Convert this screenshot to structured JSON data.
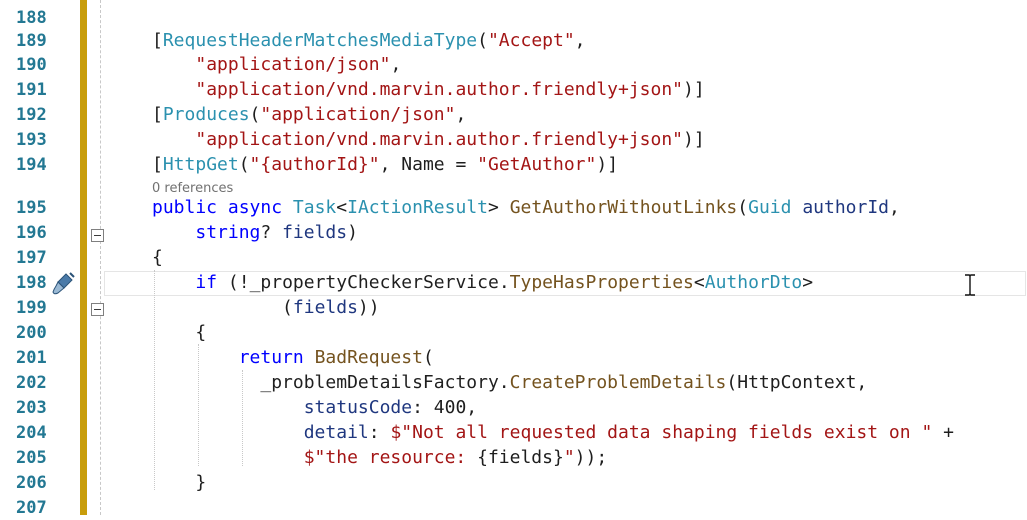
{
  "editor": {
    "codelens": "0 references",
    "lines": [
      {
        "n": "188",
        "tokens": []
      },
      {
        "n": "189",
        "tokens": [
          {
            "t": "[",
            "c": "p"
          },
          {
            "t": "RequestHeaderMatchesMediaType",
            "c": "ty"
          },
          {
            "t": "(",
            "c": "p"
          },
          {
            "t": "\"Accept\"",
            "c": "st"
          },
          {
            "t": ",",
            "c": "p"
          }
        ]
      },
      {
        "n": "190",
        "tokens": [
          {
            "t": "    ",
            "c": "p"
          },
          {
            "t": "\"application/json\"",
            "c": "st"
          },
          {
            "t": ",",
            "c": "p"
          }
        ]
      },
      {
        "n": "191",
        "tokens": [
          {
            "t": "    ",
            "c": "p"
          },
          {
            "t": "\"application/vnd.marvin.author.friendly+json\"",
            "c": "st"
          },
          {
            "t": ")]",
            "c": "p"
          }
        ]
      },
      {
        "n": "192",
        "tokens": [
          {
            "t": "[",
            "c": "p"
          },
          {
            "t": "Produces",
            "c": "ty"
          },
          {
            "t": "(",
            "c": "p"
          },
          {
            "t": "\"application/json\"",
            "c": "st"
          },
          {
            "t": ",",
            "c": "p"
          }
        ]
      },
      {
        "n": "193",
        "tokens": [
          {
            "t": "    ",
            "c": "p"
          },
          {
            "t": "\"application/vnd.marvin.author.friendly+json\"",
            "c": "st"
          },
          {
            "t": ")]",
            "c": "p"
          }
        ]
      },
      {
        "n": "194",
        "tokens": [
          {
            "t": "[",
            "c": "p"
          },
          {
            "t": "HttpGet",
            "c": "ty"
          },
          {
            "t": "(",
            "c": "p"
          },
          {
            "t": "\"{authorId}\"",
            "c": "st"
          },
          {
            "t": ", Name = ",
            "c": "p"
          },
          {
            "t": "\"GetAuthor\"",
            "c": "st"
          },
          {
            "t": ")]",
            "c": "p"
          }
        ]
      },
      {
        "n": "195",
        "tokens": [
          {
            "t": "public",
            "c": "kw"
          },
          {
            "t": " ",
            "c": "p"
          },
          {
            "t": "async",
            "c": "kw"
          },
          {
            "t": " ",
            "c": "p"
          },
          {
            "t": "Task",
            "c": "ty"
          },
          {
            "t": "<",
            "c": "p"
          },
          {
            "t": "IActionResult",
            "c": "ty"
          },
          {
            "t": "> ",
            "c": "p"
          },
          {
            "t": "GetAuthorWithoutLinks",
            "c": "me"
          },
          {
            "t": "(",
            "c": "p"
          },
          {
            "t": "Guid",
            "c": "ty"
          },
          {
            "t": " ",
            "c": "p"
          },
          {
            "t": "authorId",
            "c": "pa"
          },
          {
            "t": ",",
            "c": "p"
          }
        ]
      },
      {
        "n": "196",
        "tokens": [
          {
            "t": "    ",
            "c": "p"
          },
          {
            "t": "string",
            "c": "kw"
          },
          {
            "t": "? ",
            "c": "p"
          },
          {
            "t": "fields",
            "c": "pa"
          },
          {
            "t": ")",
            "c": "p"
          }
        ]
      },
      {
        "n": "197",
        "tokens": [
          {
            "t": "{",
            "c": "p"
          }
        ]
      },
      {
        "n": "198",
        "tokens": [
          {
            "t": "    ",
            "c": "p"
          },
          {
            "t": "if",
            "c": "kw"
          },
          {
            "t": " (!",
            "c": "p"
          },
          {
            "t": "_propertyCheckerService",
            "c": "fi"
          },
          {
            "t": ".",
            "c": "p"
          },
          {
            "t": "TypeHasProperties",
            "c": "me"
          },
          {
            "t": "<",
            "c": "p"
          },
          {
            "t": "AuthorDto",
            "c": "ty"
          },
          {
            "t": ">",
            "c": "p"
          }
        ]
      },
      {
        "n": "199",
        "tokens": [
          {
            "t": "            (",
            "c": "p"
          },
          {
            "t": "fields",
            "c": "pa"
          },
          {
            "t": "))",
            "c": "p"
          }
        ]
      },
      {
        "n": "200",
        "tokens": [
          {
            "t": "    {",
            "c": "p"
          }
        ]
      },
      {
        "n": "201",
        "tokens": [
          {
            "t": "        ",
            "c": "p"
          },
          {
            "t": "return",
            "c": "kw"
          },
          {
            "t": " ",
            "c": "p"
          },
          {
            "t": "BadRequest",
            "c": "me"
          },
          {
            "t": "(",
            "c": "p"
          }
        ]
      },
      {
        "n": "202",
        "tokens": [
          {
            "t": "          ",
            "c": "p"
          },
          {
            "t": "_problemDetailsFactory",
            "c": "fi"
          },
          {
            "t": ".",
            "c": "p"
          },
          {
            "t": "CreateProblemDetails",
            "c": "me"
          },
          {
            "t": "(HttpContext,",
            "c": "p"
          }
        ]
      },
      {
        "n": "203",
        "tokens": [
          {
            "t": "              ",
            "c": "p"
          },
          {
            "t": "statusCode",
            "c": "pa"
          },
          {
            "t": ": 400,",
            "c": "p"
          }
        ]
      },
      {
        "n": "204",
        "tokens": [
          {
            "t": "              ",
            "c": "p"
          },
          {
            "t": "detail",
            "c": "pa"
          },
          {
            "t": ": ",
            "c": "p"
          },
          {
            "t": "$\"Not all requested data shaping fields exist on \"",
            "c": "st"
          },
          {
            "t": " +",
            "c": "p"
          }
        ]
      },
      {
        "n": "205",
        "tokens": [
          {
            "t": "              ",
            "c": "p"
          },
          {
            "t": "$\"the resource: ",
            "c": "st"
          },
          {
            "t": "{fields}",
            "c": "p"
          },
          {
            "t": "\"",
            "c": "st"
          },
          {
            "t": "));",
            "c": "p"
          }
        ]
      },
      {
        "n": "206",
        "tokens": [
          {
            "t": "    }",
            "c": "p"
          }
        ]
      },
      {
        "n": "207",
        "tokens": []
      }
    ]
  },
  "icons": {
    "brush": "quick-actions-brush-icon",
    "cursor": "text-cursor-icon"
  },
  "colors": {
    "line_number": "#237893",
    "change_bar": "#c89d0c",
    "keyword": "#0000ff",
    "type": "#2b91af",
    "string": "#a31515"
  }
}
